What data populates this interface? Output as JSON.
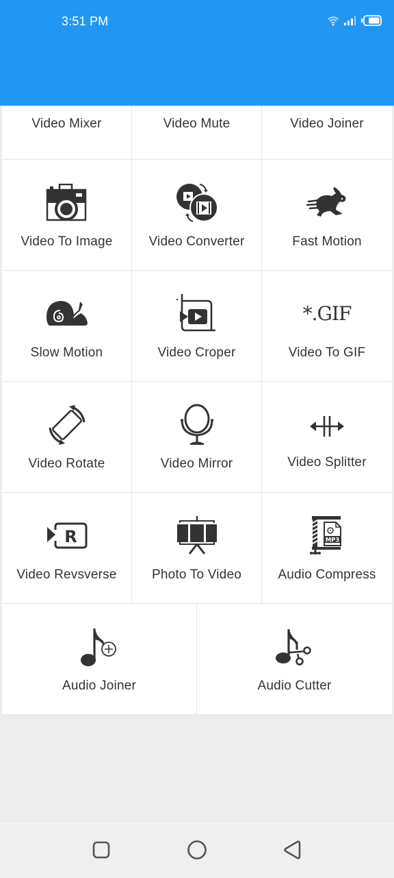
{
  "status_bar": {
    "time": "3:51 PM",
    "icons": [
      "wifi-icon",
      "signal-icon",
      "battery-icon"
    ]
  },
  "colors": {
    "app_bar": "#2196f3",
    "icon": "#333333",
    "text": "#333333",
    "background": "#ededed"
  },
  "tools": {
    "row0": [
      {
        "label": "Video Mixer",
        "icon": "video-mixer-icon"
      },
      {
        "label": "Video Mute",
        "icon": "video-mute-icon"
      },
      {
        "label": "Video Joiner",
        "icon": "video-joiner-icon"
      }
    ],
    "row1": [
      {
        "label": "Video To Image",
        "icon": "camera-icon"
      },
      {
        "label": "Video Converter",
        "icon": "video-convert-icon"
      },
      {
        "label": "Fast Motion",
        "icon": "rabbit-icon"
      }
    ],
    "row2": [
      {
        "label": "Slow Motion",
        "icon": "snail-icon"
      },
      {
        "label": "Video Croper",
        "icon": "crop-icon"
      },
      {
        "label": "Video To GIF",
        "icon": "gif-icon",
        "icon_text": "*.GIF"
      }
    ],
    "row3": [
      {
        "label": "Video Rotate",
        "icon": "rotate-icon"
      },
      {
        "label": "Video Mirror",
        "icon": "mirror-icon"
      },
      {
        "label": "Video Splitter",
        "icon": "split-icon"
      }
    ],
    "row4": [
      {
        "label": "Video Revsverse",
        "icon": "reverse-icon",
        "icon_text": "R"
      },
      {
        "label": "Photo To Video",
        "icon": "slideshow-icon"
      },
      {
        "label": "Audio Compress",
        "icon": "compress-icon",
        "icon_text": "MP3"
      }
    ],
    "row5": [
      {
        "label": "Audio Joiner",
        "icon": "music-add-icon"
      },
      {
        "label": "Audio Cutter",
        "icon": "music-cut-icon"
      }
    ]
  },
  "nav_bar": {
    "buttons": [
      "recents",
      "home",
      "back"
    ]
  }
}
